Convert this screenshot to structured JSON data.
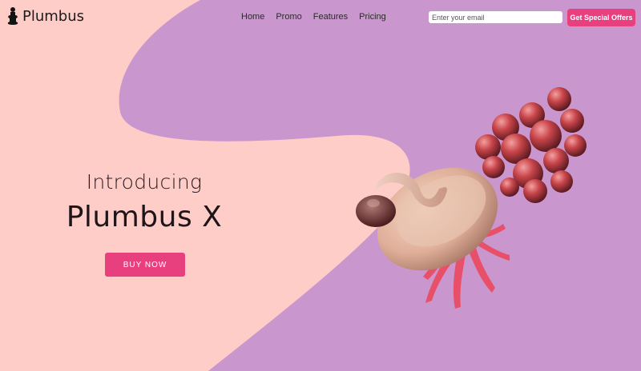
{
  "brand": {
    "name": "Plumbus",
    "logo_icon": "plumbus-silhouette-icon"
  },
  "nav": {
    "items": [
      "Home",
      "Promo",
      "Features",
      "Pricing"
    ]
  },
  "signup": {
    "email_placeholder": "Enter your email",
    "button_label": "Get Special Offers"
  },
  "hero": {
    "intro": "Introducing",
    "title": "Plumbus X",
    "cta_label": "BUY NOW"
  },
  "colors": {
    "background": "#c997ce",
    "blob": "#ffcdc8",
    "accent": "#e8407f"
  }
}
